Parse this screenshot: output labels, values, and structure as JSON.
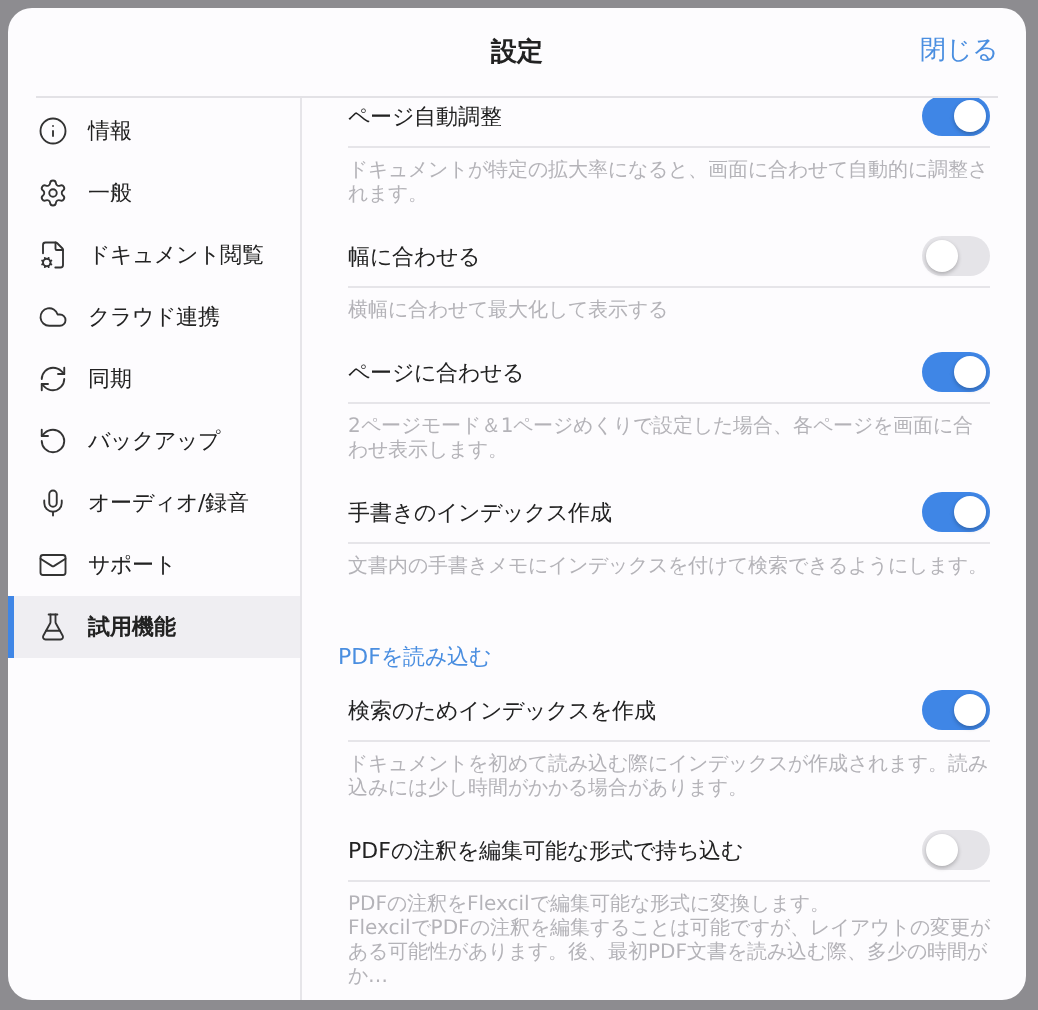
{
  "dialog": {
    "title": "設定",
    "close_button": "閉じる"
  },
  "sidebar": {
    "items": [
      {
        "label": "情報",
        "selected": false
      },
      {
        "label": "一般",
        "selected": false
      },
      {
        "label": "ドキュメント閲覧",
        "selected": false
      },
      {
        "label": "クラウド連携",
        "selected": false
      },
      {
        "label": "同期",
        "selected": false
      },
      {
        "label": "バックアップ",
        "selected": false
      },
      {
        "label": "オーディオ/録音",
        "selected": false
      },
      {
        "label": "サポート",
        "selected": false
      },
      {
        "label": "試用機能",
        "selected": true
      }
    ]
  },
  "content": {
    "sections": [
      {
        "rows": [
          {
            "label": "ページ自動調整",
            "on": true,
            "description": "ドキュメントが特定の拡大率になると、画面に合わせて自動的に調整されます。"
          },
          {
            "label": "幅に合わせる",
            "on": false,
            "description": "横幅に合わせて最大化して表示する"
          },
          {
            "label": "ページに合わせる",
            "on": true,
            "description": "2ページモード＆1ページめくりで設定した場合、各ページを画面に合わせ表示します。"
          },
          {
            "label": "手書きのインデックス作成",
            "on": true,
            "description": "文書内の手書きメモにインデックスを付けて検索できるようにします。"
          }
        ]
      },
      {
        "header": "PDFを読み込む",
        "rows": [
          {
            "label": "検索のためインデックスを作成",
            "on": true,
            "description": "ドキュメントを初めて読み込む際にインデックスが作成されます。読み込みには少し時間がかかる場合があります。"
          },
          {
            "label": "PDFの注釈を編集可能な形式で持ち込む",
            "on": false,
            "description": "PDFの注釈をFlexcilで編集可能な形式に変換します。\nFlexcilでPDFの注釈を編集することは可能ですが、レイアウトの変更がある可能性があります。後、最初PDF文書を読み込む際、多少の時間がか…"
          }
        ]
      }
    ]
  }
}
